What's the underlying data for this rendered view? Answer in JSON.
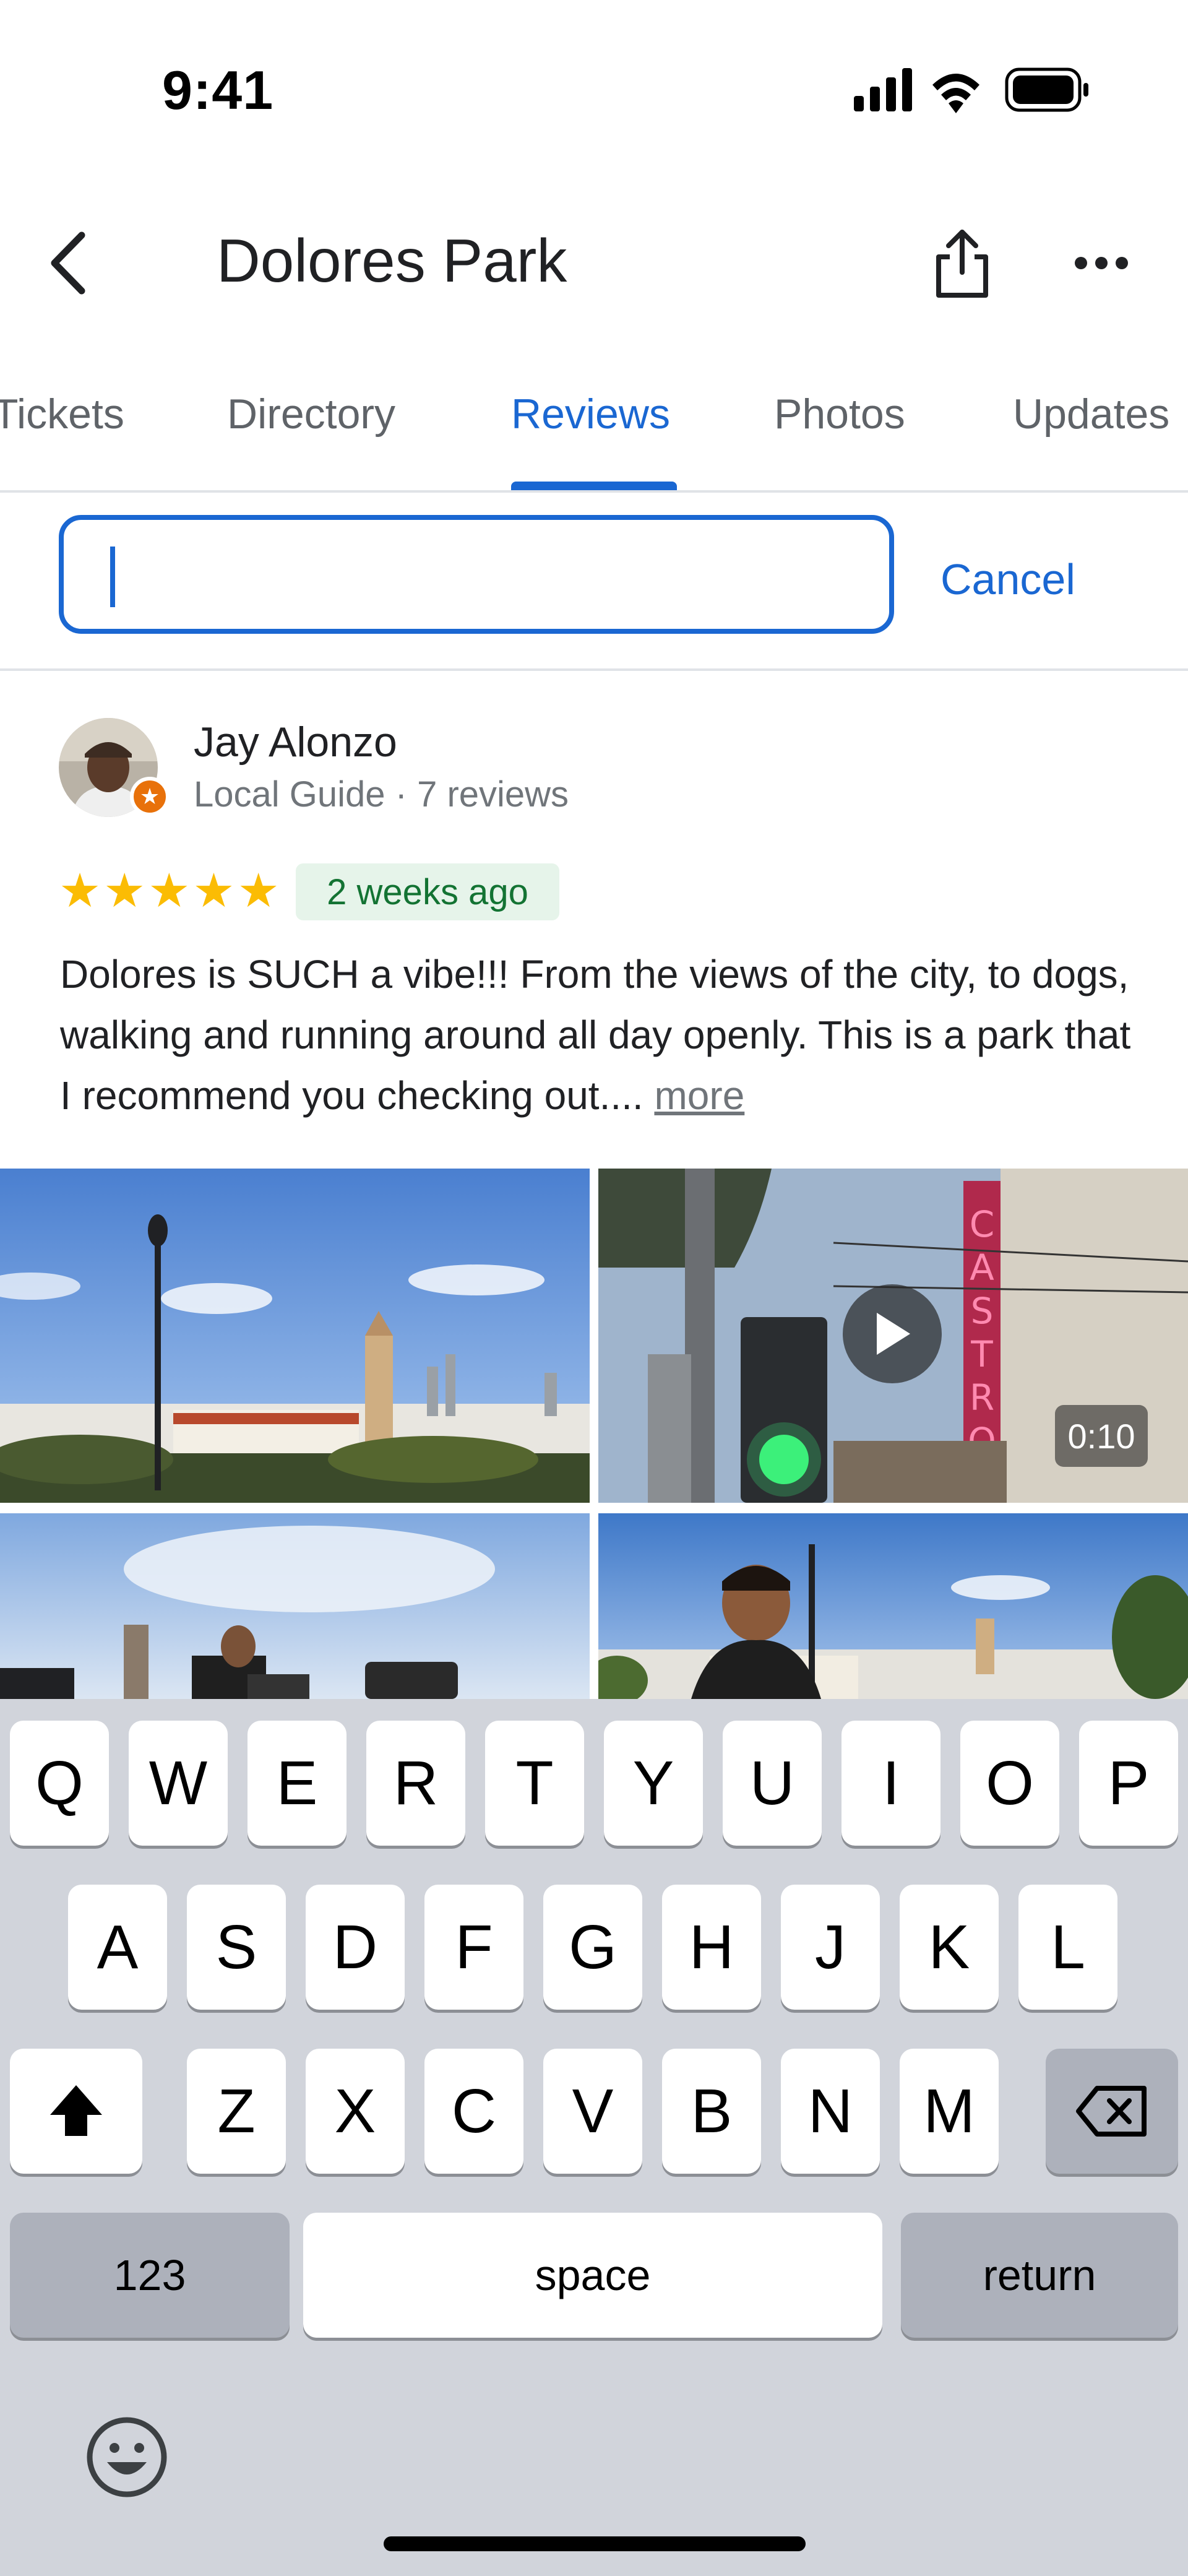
{
  "status_bar": {
    "time": "9:41"
  },
  "header": {
    "title": "Dolores Park",
    "back_icon": "chevron-left-icon",
    "share_icon": "share-icon",
    "more_icon": "more-horizontal-icon"
  },
  "tabs": [
    {
      "label": "Tickets",
      "active": false
    },
    {
      "label": "Directory",
      "active": false
    },
    {
      "label": "Reviews",
      "active": true
    },
    {
      "label": "Photos",
      "active": false
    },
    {
      "label": "Updates",
      "active": false
    }
  ],
  "search": {
    "value": "",
    "placeholder": "",
    "cancel_label": "Cancel"
  },
  "review": {
    "author": "Jay Alonzo",
    "meta": "Local Guide · 7 reviews",
    "rating": 5,
    "rating_max": 5,
    "date": "2 weeks ago",
    "text": "Dolores is SUCH a vibe!!! From the views of the city, to dogs, walking and running around all day openly. This is a park that I recommend you checking out....",
    "more_label": "more",
    "video_duration": "0:10"
  },
  "keyboard": {
    "row1": [
      "Q",
      "W",
      "E",
      "R",
      "T",
      "Y",
      "U",
      "I",
      "O",
      "P"
    ],
    "row2": [
      "A",
      "S",
      "D",
      "F",
      "G",
      "H",
      "J",
      "K",
      "L"
    ],
    "row3": [
      "Z",
      "X",
      "C",
      "V",
      "B",
      "N",
      "M"
    ],
    "numbers_label": "123",
    "space_label": "space",
    "return_label": "return"
  },
  "colors": {
    "accent": "#1a67d2",
    "star": "#fbbc04",
    "badge_bg": "#e6f4ea",
    "badge_text": "#137333",
    "local_guide": "#e8710a"
  }
}
